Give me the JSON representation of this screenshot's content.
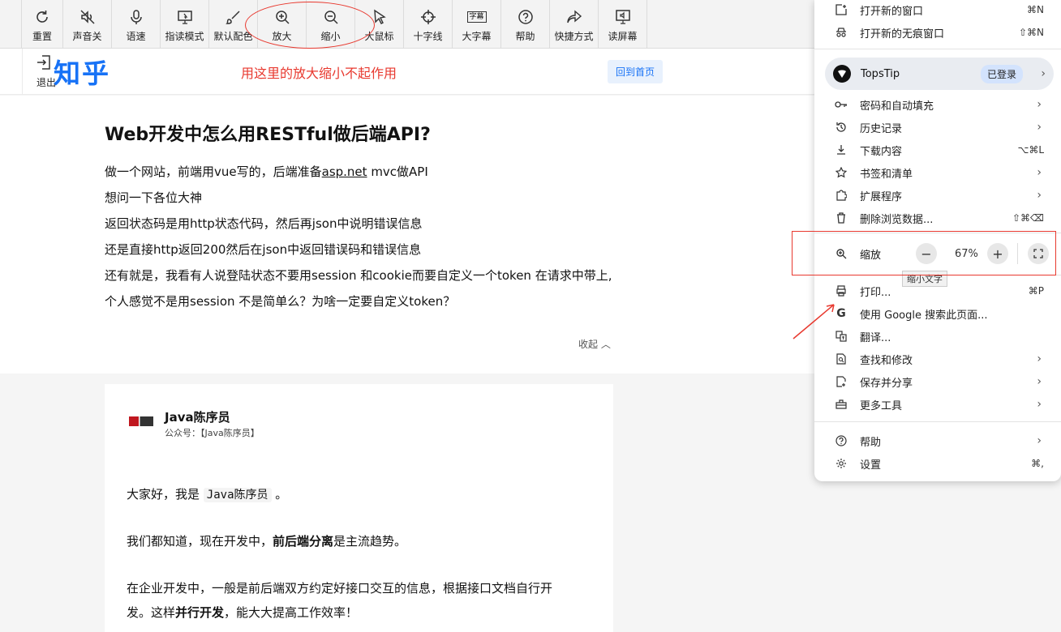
{
  "toolbar": {
    "items": [
      {
        "label": "重置",
        "icon": "reset-icon"
      },
      {
        "label": "声音关",
        "icon": "sound-off-icon"
      },
      {
        "label": "语速",
        "icon": "microphone-icon"
      },
      {
        "label": "指读模式",
        "icon": "point-read-icon"
      },
      {
        "label": "默认配色",
        "icon": "brush-icon"
      },
      {
        "label": "放大",
        "icon": "zoom-in-icon"
      },
      {
        "label": "缩小",
        "icon": "zoom-out-icon"
      },
      {
        "label": "大鼠标",
        "icon": "cursor-icon"
      },
      {
        "label": "十字线",
        "icon": "crosshair-icon"
      },
      {
        "label": "大字幕",
        "icon": "caption-icon"
      },
      {
        "label": "帮助",
        "icon": "help-icon"
      },
      {
        "label": "快捷方式",
        "icon": "share-icon"
      },
      {
        "label": "读屏幕",
        "icon": "screen-reader-icon"
      }
    ],
    "caption_icon_text": "字幕"
  },
  "header": {
    "exit_label": "退出",
    "logo": "知乎",
    "annotation": "用这里的放大缩小不起作用",
    "home_button": "回到首页"
  },
  "question": {
    "title": "Web开发中怎么用RESTful做后端API?",
    "line1_pre": "做一个网站，前端用vue写的，后端准备",
    "line1_link": "asp.net",
    "line1_post": " mvc做API",
    "line2": "想问一下各位大神",
    "line3": "返回状态码是用http状态代码，然后再json中说明错误信息",
    "line4": "还是直接http返回200然后在json中返回错误码和错误信息",
    "line5": "还有就是，我看有人说登陆状态不要用session 和cookie而要自定义一个token 在请求中带上,",
    "line6": "个人感觉不是用session 不是简单么？为啥一定要自定义token？",
    "collapse": "收起 ︿"
  },
  "answer": {
    "author": "Java陈序员",
    "author_desc": "公众号：【Java陈序员】",
    "p1_pre": "大家好，我是 ",
    "p1_code": "Java陈序员",
    "p1_post": " 。",
    "p2_pre": "我们都知道，现在开发中，",
    "p2_bold": "前后端分离",
    "p2_post": "是主流趋势。",
    "p3_line1": "在企业开发中，一般是前后端双方约定好接口交互的信息，根据接口文档自行开",
    "p3_pre": "发。这样",
    "p3_bold": "并行开发",
    "p3_post": "，能大大提高工作效率！"
  },
  "menu": {
    "new_window": {
      "label": "打开新的窗口",
      "shortcut": "⌘N"
    },
    "incognito": {
      "label": "打开新的无痕窗口",
      "shortcut": "⇧⌘N"
    },
    "profile": {
      "name": "TopsTip",
      "badge": "已登录"
    },
    "passwords": {
      "label": "密码和自动填充"
    },
    "history": {
      "label": "历史记录"
    },
    "downloads": {
      "label": "下载内容",
      "shortcut": "⌥⌘L"
    },
    "bookmarks": {
      "label": "书签和清单"
    },
    "extensions": {
      "label": "扩展程序"
    },
    "clear_data": {
      "label": "删除浏览数据...",
      "shortcut": "⇧⌘⌫"
    },
    "zoom": {
      "label": "缩放",
      "value": "67%",
      "minus": "−",
      "plus": "+",
      "tooltip": "缩小文字"
    },
    "print": {
      "label": "打印...",
      "shortcut": "⌘P"
    },
    "google_search": {
      "label": "使用 Google 搜索此页面..."
    },
    "translate": {
      "label": "翻译..."
    },
    "find_edit": {
      "label": "查找和修改"
    },
    "save_share": {
      "label": "保存并分享"
    },
    "more_tools": {
      "label": "更多工具"
    },
    "help": {
      "label": "帮助"
    },
    "settings": {
      "label": "设置",
      "shortcut": "⌘,"
    }
  },
  "colors": {
    "accent": "#1772f6",
    "annotation": "#e8392f",
    "menu_bg": "#ffffff"
  }
}
